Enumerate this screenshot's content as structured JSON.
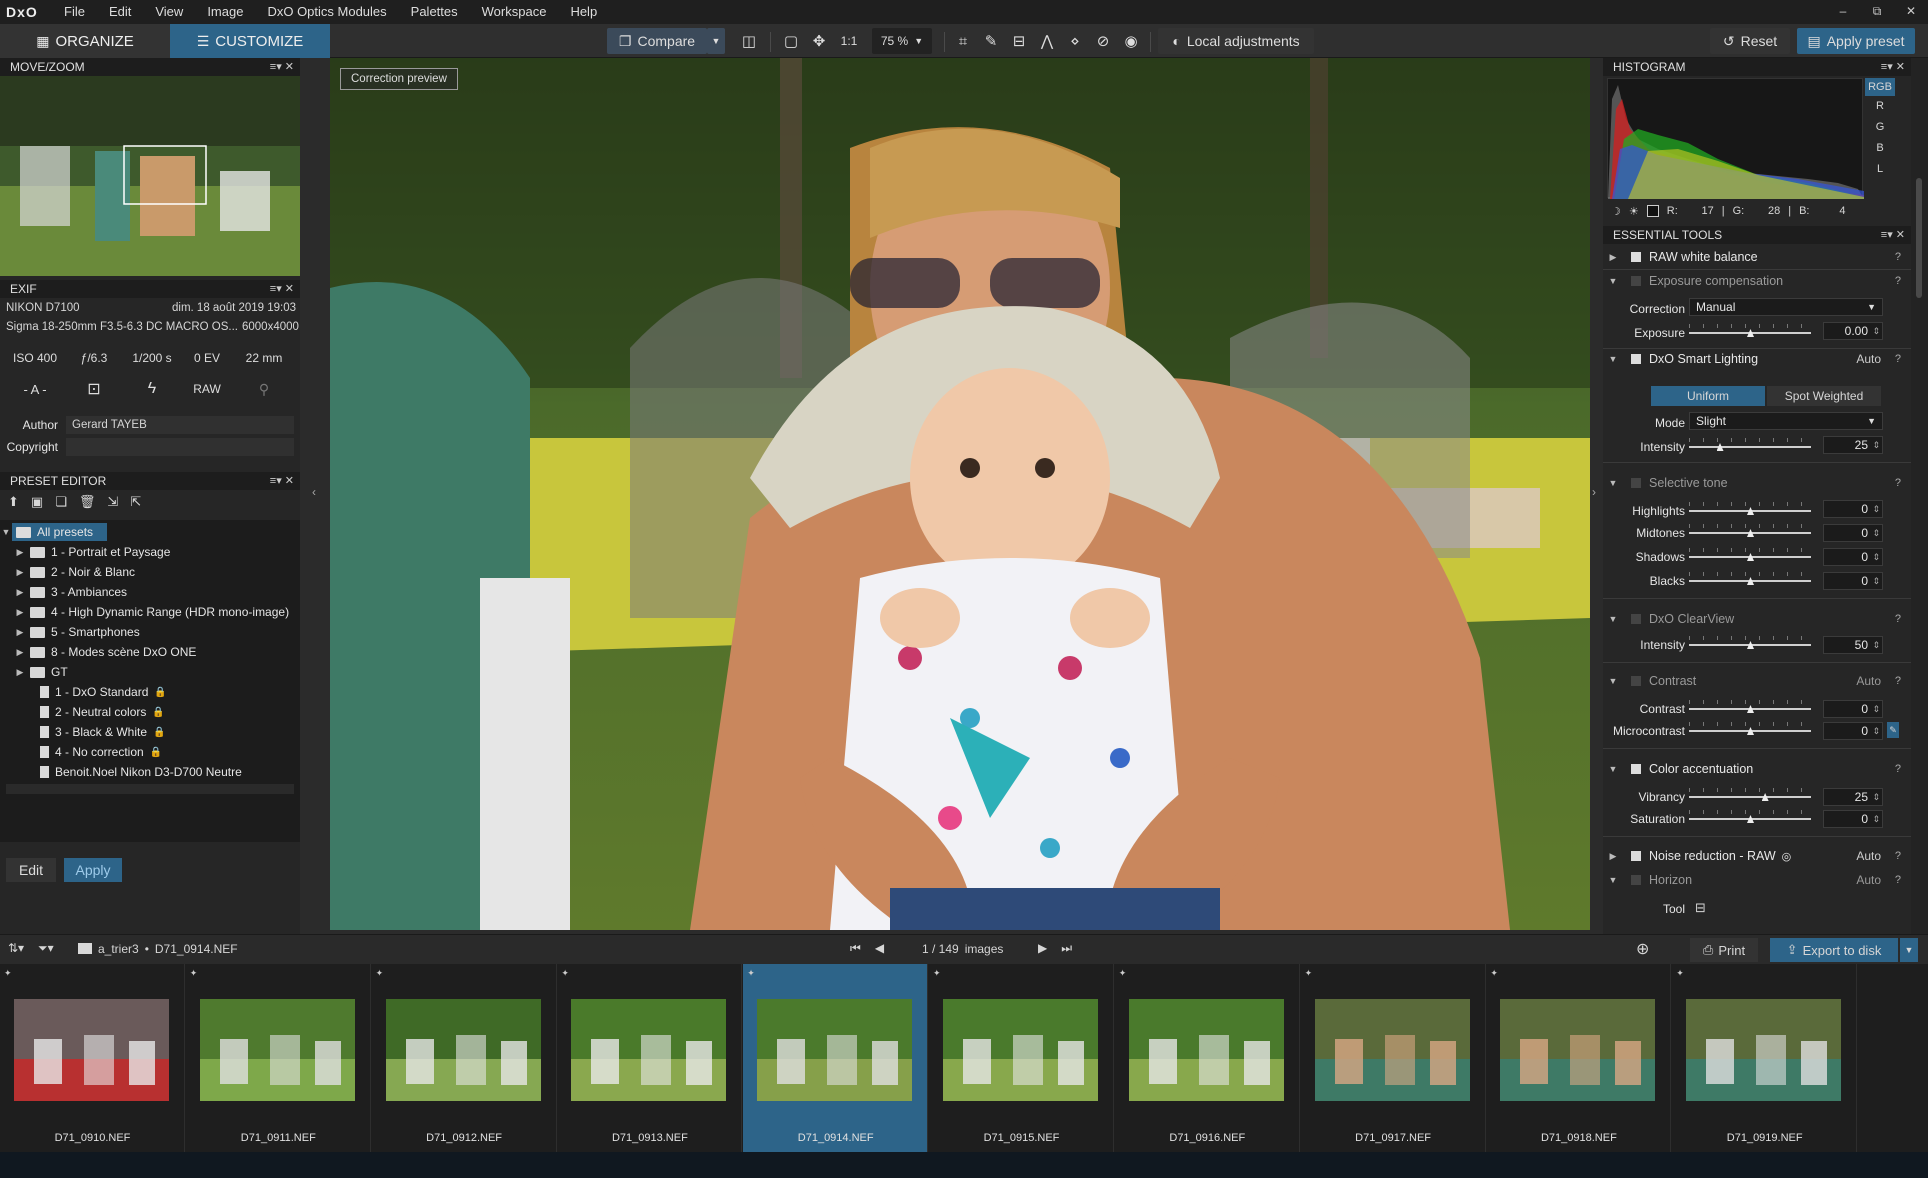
{
  "app": {
    "logo": "DxO",
    "menu": [
      "File",
      "Edit",
      "View",
      "Image",
      "DxO Optics Modules",
      "Palettes",
      "Workspace",
      "Help"
    ],
    "window_controls": [
      "–",
      "⧉",
      "✕"
    ]
  },
  "toolbar": {
    "organize": "ORGANIZE",
    "customize": "CUSTOMIZE",
    "compare": "Compare",
    "one_to_one": "1:1",
    "zoom": "75 %",
    "local_adjustments": "Local adjustments",
    "reset": "Reset",
    "apply_preset": "Apply preset"
  },
  "move_zoom": {
    "title": "MOVE/ZOOM"
  },
  "exif": {
    "title": "EXIF",
    "camera": "NIKON D7100",
    "date": "dim. 18 août 2019 19:03",
    "lens": "Sigma 18-250mm F3.5-6.3 DC MACRO OS...",
    "resolution": "6000x4000",
    "iso": "ISO 400",
    "aperture": "ƒ/6.3",
    "shutter": "1/200 s",
    "ev": "0 EV",
    "focal": "22 mm",
    "mode": "- A -",
    "raw": "RAW",
    "author_label": "Author",
    "author": "Gerard TAYEB",
    "copyright_label": "Copyright",
    "copyright": ""
  },
  "preset_editor": {
    "title": "PRESET EDITOR",
    "root": "All presets",
    "folders": [
      "1 - Portrait et Paysage",
      "2 - Noir & Blanc",
      "3 - Ambiances",
      "4 - High Dynamic Range (HDR mono-image)",
      "5 - Smartphones",
      "8 - Modes scène DxO ONE",
      "GT"
    ],
    "files": [
      "1 - DxO Standard",
      "2 - Neutral colors",
      "3 - Black & White",
      "4 - No correction",
      "Benoit.Noel Nikon D3-D700 Neutre"
    ],
    "locked": [
      true,
      true,
      true,
      true,
      false
    ],
    "edit": "Edit",
    "apply": "Apply"
  },
  "viewer": {
    "badge": "Correction preview"
  },
  "histogram": {
    "title": "HISTOGRAM",
    "channels": [
      "RGB",
      "R",
      "G",
      "B",
      "L"
    ],
    "r_label": "R:",
    "r": "17",
    "g_label": "G:",
    "g": "28",
    "b_label": "B:",
    "b": "4"
  },
  "essential_tools": {
    "title": "ESSENTIAL TOOLS",
    "raw_wb": "RAW white balance",
    "exposure": {
      "name": "Exposure compensation",
      "correction_label": "Correction",
      "correction": "Manual",
      "exposure_label": "Exposure",
      "exposure_value": "0.00",
      "exposure_pos": 0.5
    },
    "smart_lighting": {
      "name": "DxO Smart Lighting",
      "auto": "Auto",
      "uniform": "Uniform",
      "spot": "Spot Weighted",
      "mode_label": "Mode",
      "mode": "Slight",
      "intensity_label": "Intensity",
      "intensity": "25",
      "intensity_pos": 0.25
    },
    "selective_tone": {
      "name": "Selective tone",
      "rows": [
        {
          "label": "Highlights",
          "value": "0",
          "pos": 0.5
        },
        {
          "label": "Midtones",
          "value": "0",
          "pos": 0.5
        },
        {
          "label": "Shadows",
          "value": "0",
          "pos": 0.5
        },
        {
          "label": "Blacks",
          "value": "0",
          "pos": 0.5
        }
      ]
    },
    "clearview": {
      "name": "DxO ClearView",
      "intensity_label": "Intensity",
      "intensity": "50",
      "pos": 0.5
    },
    "contrast": {
      "name": "Contrast",
      "auto": "Auto",
      "rows": [
        {
          "label": "Contrast",
          "value": "0",
          "pos": 0.5
        },
        {
          "label": "Microcontrast",
          "value": "0",
          "pos": 0.5
        }
      ]
    },
    "color_accentuation": {
      "name": "Color accentuation",
      "rows": [
        {
          "label": "Vibrancy",
          "value": "25",
          "pos": 0.62
        },
        {
          "label": "Saturation",
          "value": "0",
          "pos": 0.5
        }
      ]
    },
    "noise": {
      "name": "Noise reduction - RAW",
      "auto": "Auto"
    },
    "horizon": {
      "name": "Horizon",
      "auto": "Auto",
      "tool_label": "Tool"
    }
  },
  "filmstrip": {
    "path_folder": "a_trier3",
    "path_file": "D71_0914.NEF",
    "counter": "1 / 149",
    "images_label": "images",
    "print": "Print",
    "export": "Export to disk",
    "thumbs": [
      "D71_0910.NEF",
      "D71_0911.NEF",
      "D71_0912.NEF",
      "D71_0913.NEF",
      "D71_0914.NEF",
      "D71_0915.NEF",
      "D71_0916.NEF",
      "D71_0917.NEF",
      "D71_0918.NEF",
      "D71_0919.NEF"
    ],
    "active_index": 4
  },
  "colors": {
    "accent": "#2d6489",
    "panel": "#262626",
    "header": "#1d1d1d"
  }
}
